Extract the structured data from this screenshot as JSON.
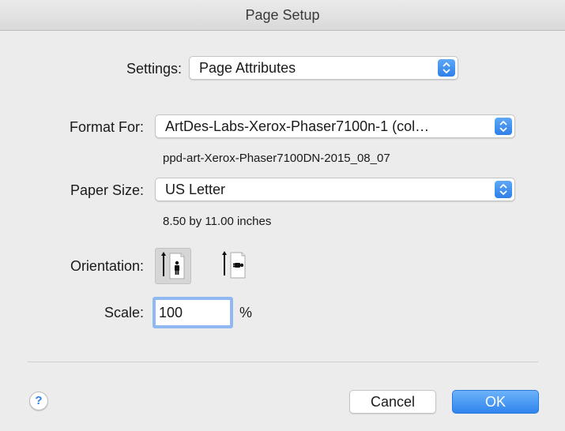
{
  "window": {
    "title": "Page Setup"
  },
  "settings": {
    "label": "Settings:",
    "value": "Page Attributes"
  },
  "format_for": {
    "label": "Format For:",
    "value": "ArtDes-Labs-Xerox-Phaser7100n-1 (col…",
    "info": "ppd-art-Xerox-Phaser7100DN-2015_08_07"
  },
  "paper_size": {
    "label": "Paper Size:",
    "value": "US Letter",
    "info": "8.50 by 11.00 inches"
  },
  "orientation": {
    "label": "Orientation:",
    "options": [
      {
        "icon": "portrait-orientation-icon",
        "selected": true
      },
      {
        "icon": "landscape-orientation-icon",
        "selected": false
      }
    ]
  },
  "scale": {
    "label": "Scale:",
    "value": "100",
    "unit": "%"
  },
  "buttons": {
    "help": "?",
    "cancel": "Cancel",
    "ok": "OK"
  },
  "colors": {
    "accent": "#2f84ee",
    "focus_ring": "#8fb9f0",
    "background": "#ececec"
  }
}
